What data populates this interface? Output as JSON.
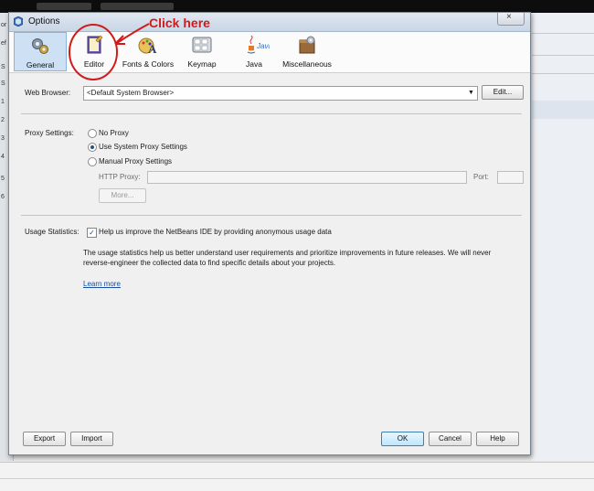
{
  "dialog": {
    "title": "Options",
    "close_symbol": "×"
  },
  "background": {
    "left_letters": [
      "or",
      "ef",
      "S",
      "S",
      "1",
      "2",
      "3",
      "4",
      "5",
      "6"
    ]
  },
  "categories": [
    {
      "label": "General",
      "icon": "gear-icon",
      "selected": true
    },
    {
      "label": "Editor",
      "icon": "editor-icon",
      "selected": false
    },
    {
      "label": "Fonts & Colors",
      "icon": "fonts-colors-icon",
      "selected": false
    },
    {
      "label": "Keymap",
      "icon": "keyboard-icon",
      "selected": false
    },
    {
      "label": "Java",
      "icon": "java-icon",
      "selected": false
    },
    {
      "label": "Miscellaneous",
      "icon": "miscellaneous-icon",
      "selected": false
    }
  ],
  "annotation": {
    "text": "Click here",
    "color": "#d01b1b"
  },
  "web_browser": {
    "label": "Web Browser:",
    "value": "<Default System Browser>",
    "edit_label": "Edit..."
  },
  "proxy": {
    "label": "Proxy Settings:",
    "options": [
      "No Proxy",
      "Use System Proxy Settings",
      "Manual Proxy Settings"
    ],
    "selected": "Use System Proxy Settings",
    "http_proxy_label": "HTTP Proxy:",
    "http_proxy_value": "",
    "port_label": "Port:",
    "port_value": "",
    "more_label": "More..."
  },
  "usage": {
    "label": "Usage Statistics:",
    "checkbox_label": "Help us improve the NetBeans IDE by providing anonymous usage data",
    "checked": true,
    "description": "The usage statistics help us better understand user requirements and prioritize improvements in future releases. We will never reverse-engineer the collected data to find specific details about your projects.",
    "learn_more": "Learn more"
  },
  "footer": {
    "export": "Export",
    "import": "Import",
    "ok": "OK",
    "cancel": "Cancel",
    "help": "Help"
  },
  "colors": {
    "accent": "#cde0f4",
    "link": "#1a4fa0",
    "annotation": "#d01b1b"
  }
}
